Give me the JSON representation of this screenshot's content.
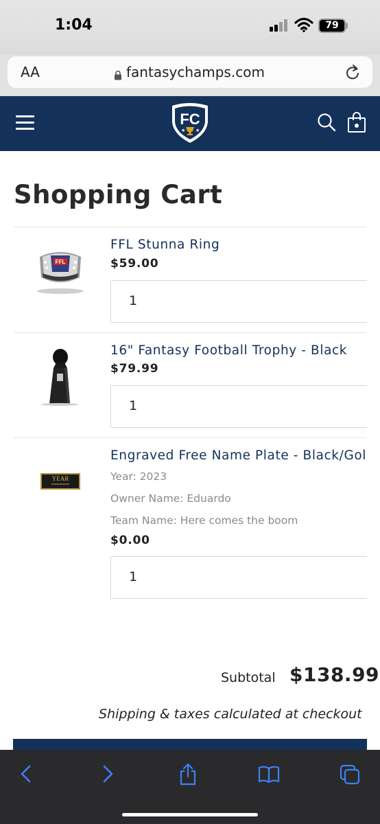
{
  "status_bar": {
    "time": "1:04",
    "battery": "79"
  },
  "browser": {
    "text_size_label": "AA",
    "url": "fantasychamps.com"
  },
  "header": {
    "logo_text": "FC"
  },
  "page_title": "Shopping Cart",
  "items": [
    {
      "name": "FFL Stunna Ring",
      "price": "$59.00",
      "quantity": "1"
    },
    {
      "name": "16\" Fantasy Football Trophy - Black",
      "price": "$79.99",
      "quantity": "1"
    },
    {
      "name": "Engraved Free Name Plate - Black/Gold",
      "options": [
        "Year: 2023",
        "Owner Name: Eduardo",
        "Team Name: Here comes the boom"
      ],
      "price": "$0.00",
      "quantity": "1",
      "plate_text": "YEAR"
    }
  ],
  "subtotal": {
    "label": "Subtotal",
    "value": "$138.99"
  },
  "shipping_note": "Shipping & taxes calculated at checkout",
  "colors": {
    "brand_navy": "#14315a",
    "safari_blue": "#3b82f6"
  }
}
